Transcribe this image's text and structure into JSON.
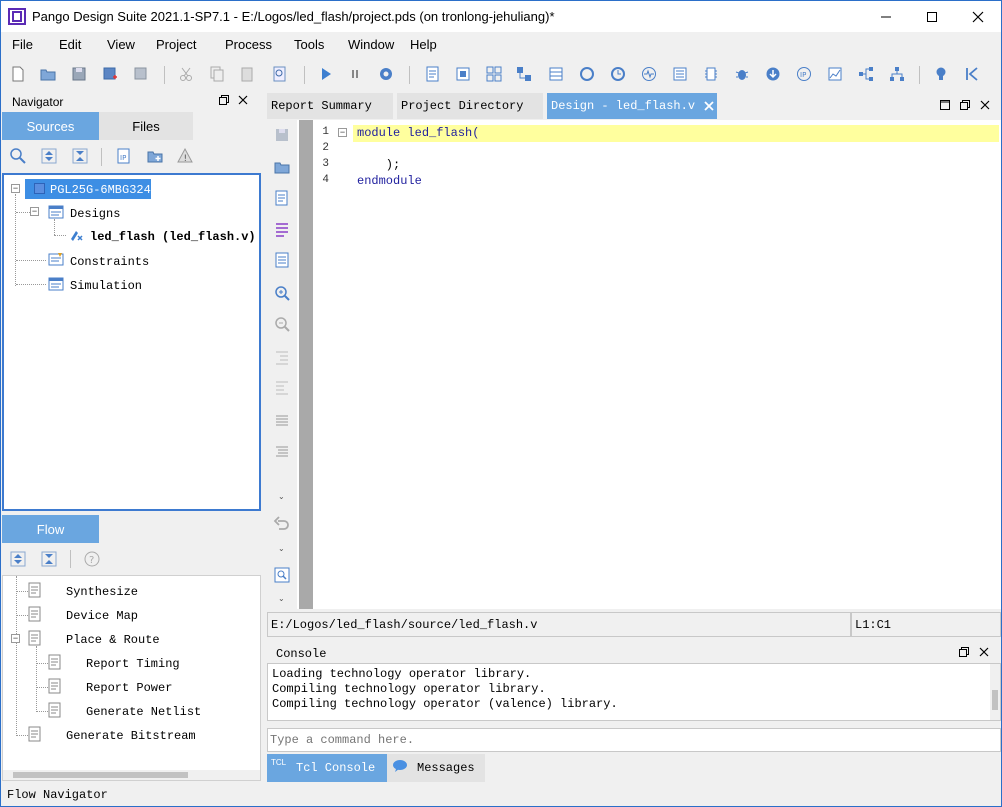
{
  "window": {
    "title": "Pango Design Suite 2021.1-SP7.1 - E:/Logos/led_flash/project.pds (on tronlong-jehuliang)*"
  },
  "menu": [
    "File",
    "Edit",
    "View",
    "Project",
    "Process",
    "Tools",
    "Window",
    "Help"
  ],
  "navigator": {
    "title": "Navigator",
    "tabs": [
      "Sources",
      "Files"
    ],
    "tree": {
      "device": "PGL25G-6MBG324",
      "designs": "Designs",
      "module": "led_flash (led_flash.v)",
      "constraints": "Constraints",
      "simulation": "Simulation"
    }
  },
  "flow": {
    "tab": "Flow",
    "items": [
      "Synthesize",
      "Device Map",
      "Place & Route",
      "Report Timing",
      "Report Power",
      "Generate Netlist",
      "Generate Bitstream"
    ]
  },
  "editor": {
    "tabs": [
      "Report Summary",
      "Project Directory",
      "Design - led_flash.v"
    ],
    "line_numbers": [
      "1",
      "2",
      "3",
      "4"
    ],
    "code": {
      "l1_keyword": "module",
      "l1_name": " led_flash(",
      "l2": "",
      "l3": "    );",
      "l4": "endmodule"
    },
    "path": "E:/Logos/led_flash/source/led_flash.v",
    "cursor": "L1:C1"
  },
  "console": {
    "title": "Console",
    "lines": [
      "Loading technology operator library.",
      "Compiling technology operator library.",
      "Compiling technology operator (valence) library."
    ],
    "placeholder": "Type a command here.",
    "tabs": [
      "Tcl Console",
      "Messages"
    ],
    "tcl_badge": "TCL"
  },
  "statusbar": {
    "text": "Flow Navigator"
  },
  "colors": {
    "accent": "#6aa6e0",
    "selection": "#3d8ee4",
    "current_line": "#ffff9e",
    "keyword": "#1f1f9e"
  }
}
